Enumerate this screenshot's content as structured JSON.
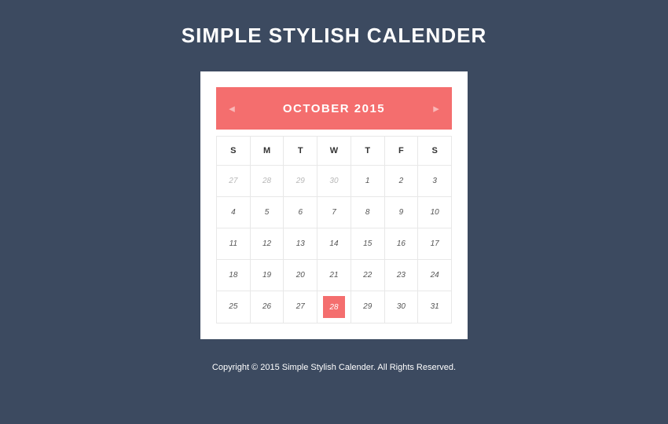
{
  "title": "SIMPLE STYLISH CALENDER",
  "calendar": {
    "month_year": "OCTOBER 2015",
    "day_headers": [
      "S",
      "M",
      "T",
      "W",
      "T",
      "F",
      "S"
    ],
    "weeks": [
      [
        {
          "day": "27",
          "muted": true,
          "selected": false
        },
        {
          "day": "28",
          "muted": true,
          "selected": false
        },
        {
          "day": "29",
          "muted": true,
          "selected": false
        },
        {
          "day": "30",
          "muted": true,
          "selected": false
        },
        {
          "day": "1",
          "muted": false,
          "selected": false
        },
        {
          "day": "2",
          "muted": false,
          "selected": false
        },
        {
          "day": "3",
          "muted": false,
          "selected": false
        }
      ],
      [
        {
          "day": "4",
          "muted": false,
          "selected": false
        },
        {
          "day": "5",
          "muted": false,
          "selected": false
        },
        {
          "day": "6",
          "muted": false,
          "selected": false
        },
        {
          "day": "7",
          "muted": false,
          "selected": false
        },
        {
          "day": "8",
          "muted": false,
          "selected": false
        },
        {
          "day": "9",
          "muted": false,
          "selected": false
        },
        {
          "day": "10",
          "muted": false,
          "selected": false
        }
      ],
      [
        {
          "day": "11",
          "muted": false,
          "selected": false
        },
        {
          "day": "12",
          "muted": false,
          "selected": false
        },
        {
          "day": "13",
          "muted": false,
          "selected": false
        },
        {
          "day": "14",
          "muted": false,
          "selected": false
        },
        {
          "day": "15",
          "muted": false,
          "selected": false
        },
        {
          "day": "16",
          "muted": false,
          "selected": false
        },
        {
          "day": "17",
          "muted": false,
          "selected": false
        }
      ],
      [
        {
          "day": "18",
          "muted": false,
          "selected": false
        },
        {
          "day": "19",
          "muted": false,
          "selected": false
        },
        {
          "day": "20",
          "muted": false,
          "selected": false
        },
        {
          "day": "21",
          "muted": false,
          "selected": false
        },
        {
          "day": "22",
          "muted": false,
          "selected": false
        },
        {
          "day": "23",
          "muted": false,
          "selected": false
        },
        {
          "day": "24",
          "muted": false,
          "selected": false
        }
      ],
      [
        {
          "day": "25",
          "muted": false,
          "selected": false
        },
        {
          "day": "26",
          "muted": false,
          "selected": false
        },
        {
          "day": "27",
          "muted": false,
          "selected": false
        },
        {
          "day": "28",
          "muted": false,
          "selected": true
        },
        {
          "day": "29",
          "muted": false,
          "selected": false
        },
        {
          "day": "30",
          "muted": false,
          "selected": false
        },
        {
          "day": "31",
          "muted": false,
          "selected": false
        }
      ]
    ]
  },
  "footer": "Copyright © 2015 Simple Stylish Calender. All Rights Reserved.",
  "colors": {
    "background": "#3c4a60",
    "accent": "#f46e6e",
    "card": "#ffffff"
  }
}
